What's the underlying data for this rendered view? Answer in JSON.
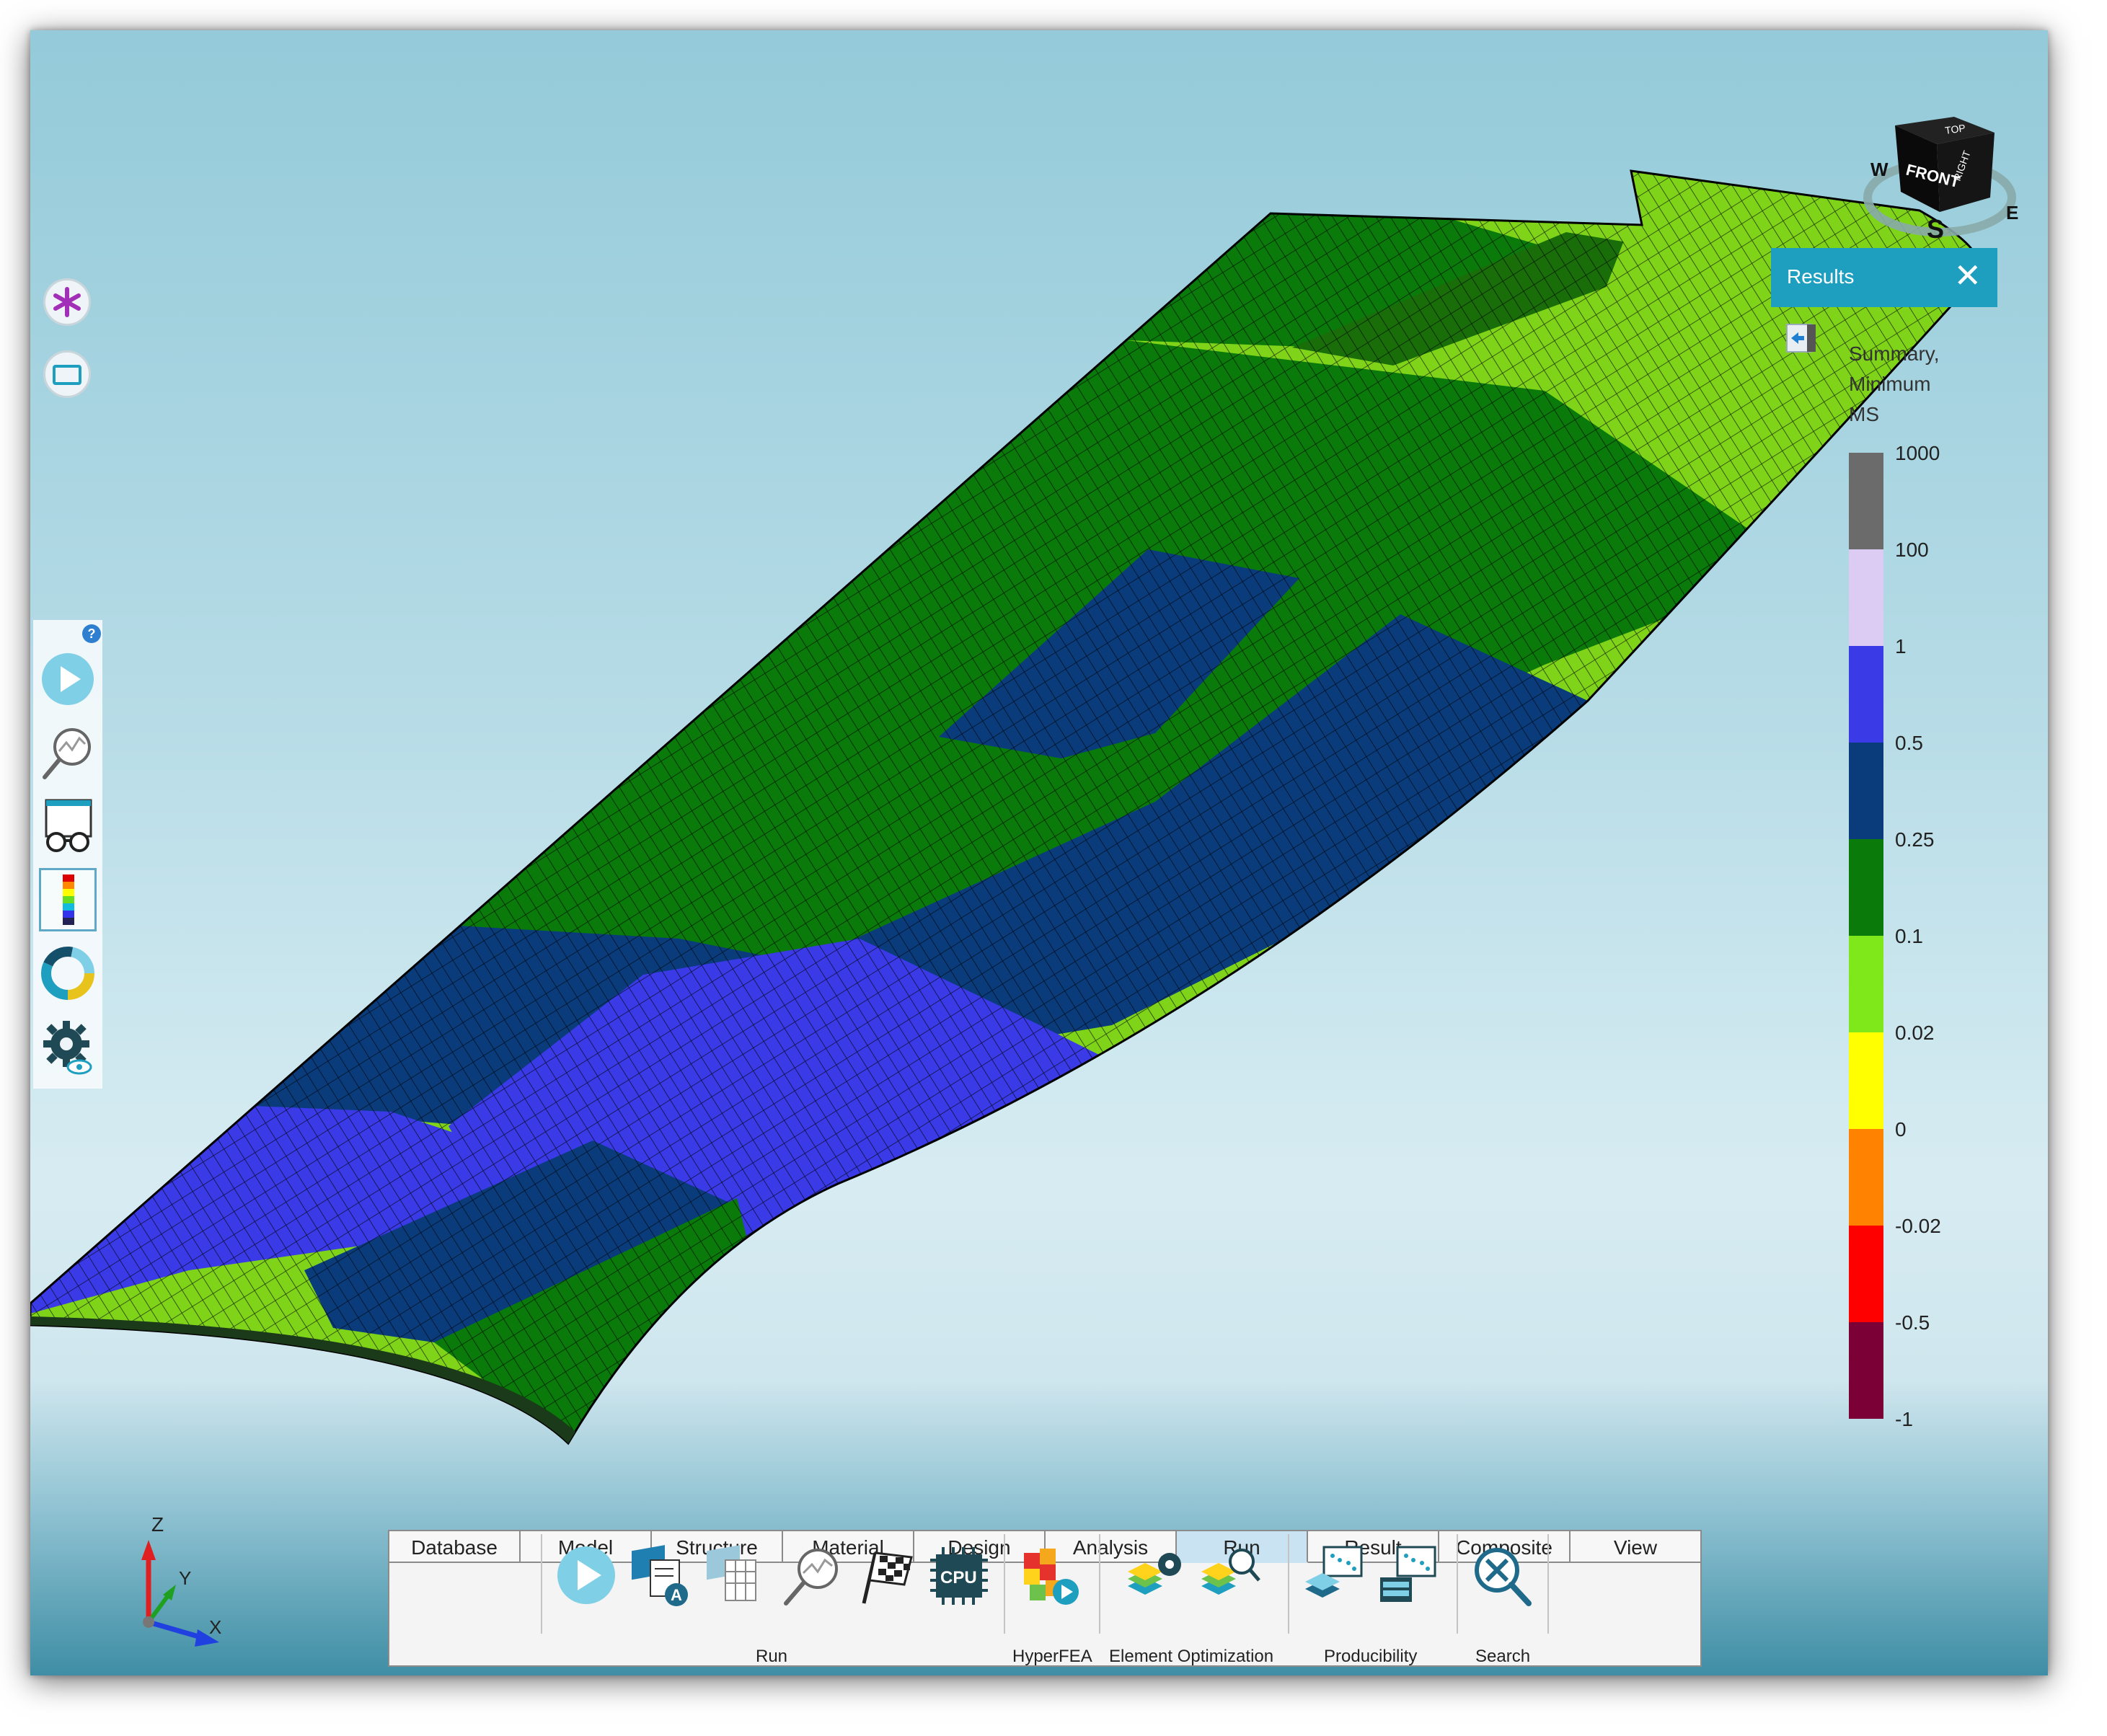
{
  "viewport": {
    "cube": {
      "top": "TOP",
      "front": "FRONT",
      "side": "RIGHT",
      "compass": [
        "S",
        "W",
        "E"
      ]
    },
    "axes": {
      "x": "X",
      "y": "Y",
      "z": "Z"
    }
  },
  "left_toolbar": {
    "help": "?"
  },
  "results_panel": {
    "title": "Results",
    "close": "✕",
    "legend_title": [
      "Summary,",
      "Minimum",
      "MS"
    ],
    "legend_labels": [
      "1000",
      "100",
      "1",
      "0.5",
      "0.25",
      "0.1",
      "0.02",
      "0",
      "-0.02",
      "-0.5",
      "-1"
    ],
    "legend_colors": [
      "#6b6b6b",
      "#dccbf3",
      "#3a3ae6",
      "#0a3c7c",
      "#0a7a0a",
      "#7fe81a",
      "#ffff00",
      "#ff8200",
      "#ff0000",
      "#7a0036"
    ]
  },
  "ribbon": {
    "tabs": [
      "Database",
      "Model",
      "Structure",
      "Material",
      "Design",
      "Analysis",
      "Run",
      "Result",
      "Composite",
      "View"
    ],
    "active_tab": "Run",
    "groups": [
      "Run",
      "HyperFEA",
      "Element Optimization",
      "Producibility",
      "Search"
    ],
    "cpu_label": "CPU"
  }
}
